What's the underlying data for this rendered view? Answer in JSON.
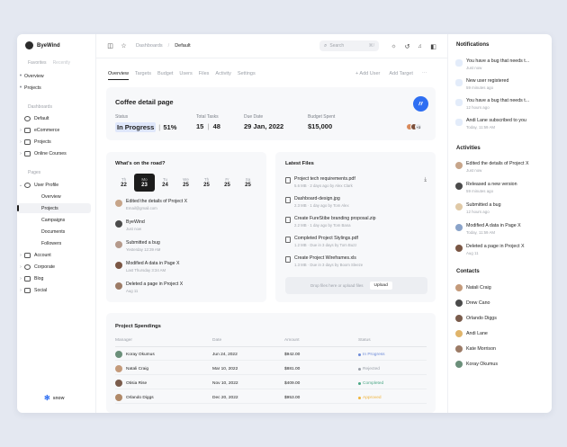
{
  "brand": {
    "name": "ByeWind"
  },
  "sidebar": {
    "tabs": [
      "Favorites",
      "Recently"
    ],
    "favorites": [
      "Overview",
      "Projects"
    ],
    "dashboards_label": "Dashboards",
    "dashboards": [
      "Default",
      "eCommerce",
      "Projects",
      "Online Courses"
    ],
    "pages_label": "Pages",
    "pages": [
      "User Profile",
      "Overview",
      "Projects",
      "Campaigns",
      "Documents",
      "Followers",
      "Account",
      "Corporate",
      "Blog",
      "Social"
    ],
    "footer_logo": "snow"
  },
  "topbar": {
    "breadcrumb": [
      "Dashboards",
      "/",
      "Default"
    ],
    "search_placeholder": "Search",
    "search_shortcut": "⌘/"
  },
  "tabs": [
    "Overview",
    "Targets",
    "Budget",
    "Users",
    "Files",
    "Activity",
    "Settings"
  ],
  "tab_actions": [
    "+ Add User",
    "Add Target"
  ],
  "project": {
    "title": "Coffee detail page",
    "status_label": "Status",
    "status_value": "In Progress",
    "status_pct": "51%",
    "tasks_label": "Total Tasks",
    "tasks_done": "15",
    "tasks_total": "48",
    "due_label": "Due Date",
    "due_value": "29 Jan, 2022",
    "budget_label": "Budget Spent",
    "budget_value": "$15,000",
    "avatars_more": "+3"
  },
  "road": {
    "title": "What's on the road?",
    "days": [
      {
        "dow": "Th",
        "num": "22"
      },
      {
        "dow": "Mo",
        "num": "23"
      },
      {
        "dow": "Tu",
        "num": "24"
      },
      {
        "dow": "We",
        "num": "25"
      },
      {
        "dow": "Th",
        "num": "25"
      },
      {
        "dow": "Fr",
        "num": "25"
      },
      {
        "dow": "Sa",
        "num": "25"
      }
    ],
    "items": [
      {
        "title": "Edited the details of Project X",
        "sub": "Email@gmail.com"
      },
      {
        "title": "ByeWind",
        "sub": "Just now"
      },
      {
        "title": "Submitted a bug",
        "sub": "Yesterday 12:39 AM"
      },
      {
        "title": "Modified A data in Page X",
        "sub": "Last Thursday 3:34 AM"
      },
      {
        "title": "Deleted a page in Project X",
        "sub": "Aug 11"
      }
    ]
  },
  "files": {
    "title": "Latest Files",
    "items": [
      {
        "name": "Project tech requirements.pdf",
        "meta": "5.6 MB · 2 days ago by Alex Clark"
      },
      {
        "name": "Dashboard-design.jpg",
        "meta": "2.3 MB · 1 day ago by Tom Alex"
      },
      {
        "name": "Create FureStibe branding proposal.zip",
        "meta": "2.2 MB · 1 day ago by Tom Bana"
      },
      {
        "name": "Completed Project Stylings.pdf",
        "meta": "1.2 MB · Due in 3 days by Tom Buzz"
      },
      {
        "name": "Create Project Wireframes.xls",
        "meta": "1.3 MB · Due in 3 days by Boom Sleeze"
      }
    ],
    "drop_text": "Drop files here or upload files",
    "upload_label": "Upload"
  },
  "spendings": {
    "title": "Project Spendings",
    "columns": [
      "Manager",
      "Date",
      "Amount",
      "Status"
    ],
    "rows": [
      {
        "manager": "Koray Okumus",
        "date": "Jun 24, 2022",
        "amount": "$942.00",
        "status": "In Progress",
        "color": "#6d8bd8"
      },
      {
        "manager": "Natali Craig",
        "date": "Mar 10, 2022",
        "amount": "$881.00",
        "status": "Rejected",
        "color": "#9aa0a9"
      },
      {
        "manager": "Otisia Rise",
        "date": "Nov 10, 2022",
        "amount": "$409.00",
        "status": "Completed",
        "color": "#4aa785"
      },
      {
        "manager": "Orlando Diggs",
        "date": "Dec 20, 2022",
        "amount": "$953.00",
        "status": "Approved",
        "color": "#f0b43c"
      }
    ]
  },
  "right": {
    "notifications_title": "Notifications",
    "notifications": [
      {
        "t": "You have a bug that needs t...",
        "s": "Just now"
      },
      {
        "t": "New user registered",
        "s": "59 minutes ago"
      },
      {
        "t": "You have a bug that needs t...",
        "s": "12 hours ago"
      },
      {
        "t": "Andi Lane subscribed to you",
        "s": "Today, 11:59 AM"
      }
    ],
    "activities_title": "Activities",
    "activities": [
      {
        "t": "Edited the details of Project X",
        "s": "Just now"
      },
      {
        "t": "Released a new version",
        "s": "59 minutes ago"
      },
      {
        "t": "Submitted a bug",
        "s": "12 hours ago"
      },
      {
        "t": "Modified A data in Page X",
        "s": "Today, 11:59 AM"
      },
      {
        "t": "Deleted a page in Project X",
        "s": "Aug 11"
      }
    ],
    "contacts_title": "Contacts",
    "contacts": [
      "Natali Craig",
      "Drew Cano",
      "Orlando Diggs",
      "Andi Lane",
      "Kate Morrison",
      "Koray Okumus"
    ]
  },
  "colors": {
    "accent": "#2f6ff2",
    "bg": "#e4e8f1"
  }
}
